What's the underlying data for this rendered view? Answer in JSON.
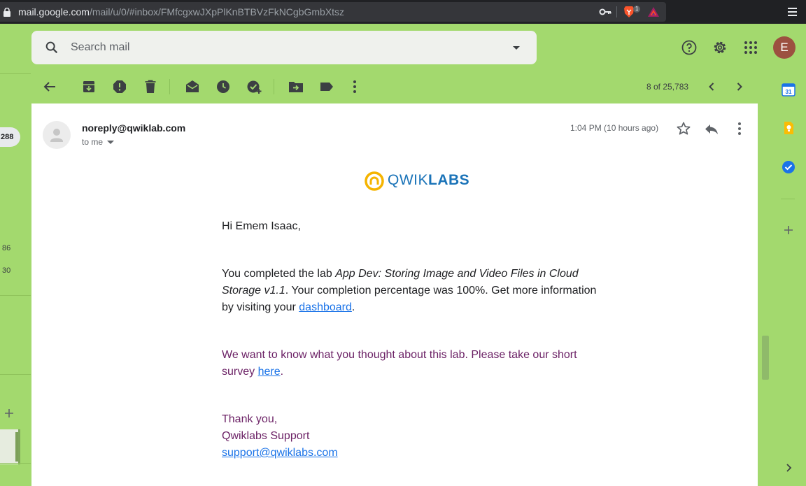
{
  "browser": {
    "url_host": "mail.google.com",
    "url_path": "/mail/u/0/#inbox/FMfcgxwJXpPlKnBTBVzFkNCgbGmbXtsz",
    "brave_badge": "1"
  },
  "header": {
    "search_placeholder": "Search mail",
    "avatar_initial": "E"
  },
  "left_strip": {
    "count_badge": "288",
    "nums": [
      "86",
      "30"
    ]
  },
  "toolbar": {
    "pager_text": "8 of 25,783"
  },
  "message": {
    "sender": "noreply@qwiklab.com",
    "recipient": "to me",
    "time": "1:04 PM (10 hours ago)",
    "brand_light": "QWIK",
    "brand_bold": "LABS",
    "greeting": "Hi Emem Isaac,",
    "p1_prefix": "You completed the lab ",
    "p1_lab_title": "App Dev: Storing Image and Video Files in Cloud Storage v1.1",
    "p1_middle": ". Your completion percentage was 100%. Get more information by visiting your ",
    "p1_link": "dashboard",
    "p1_suffix": ".",
    "p2_prefix": "We want to know what you thought about this lab. Please take our short survey ",
    "p2_link": "here",
    "p2_suffix": ".",
    "closing": "Thank you,",
    "signature": "Qwiklabs Support",
    "support_email": "support@qwiklabs.com"
  },
  "side_panel": {
    "calendar_day": "31"
  },
  "colors": {
    "theme_green": "#a3d96e",
    "link_blue": "#1a73e8",
    "survey_purple": "#6c2266",
    "brand_blue": "#1a73b8",
    "brand_yellow": "#f5b400"
  }
}
